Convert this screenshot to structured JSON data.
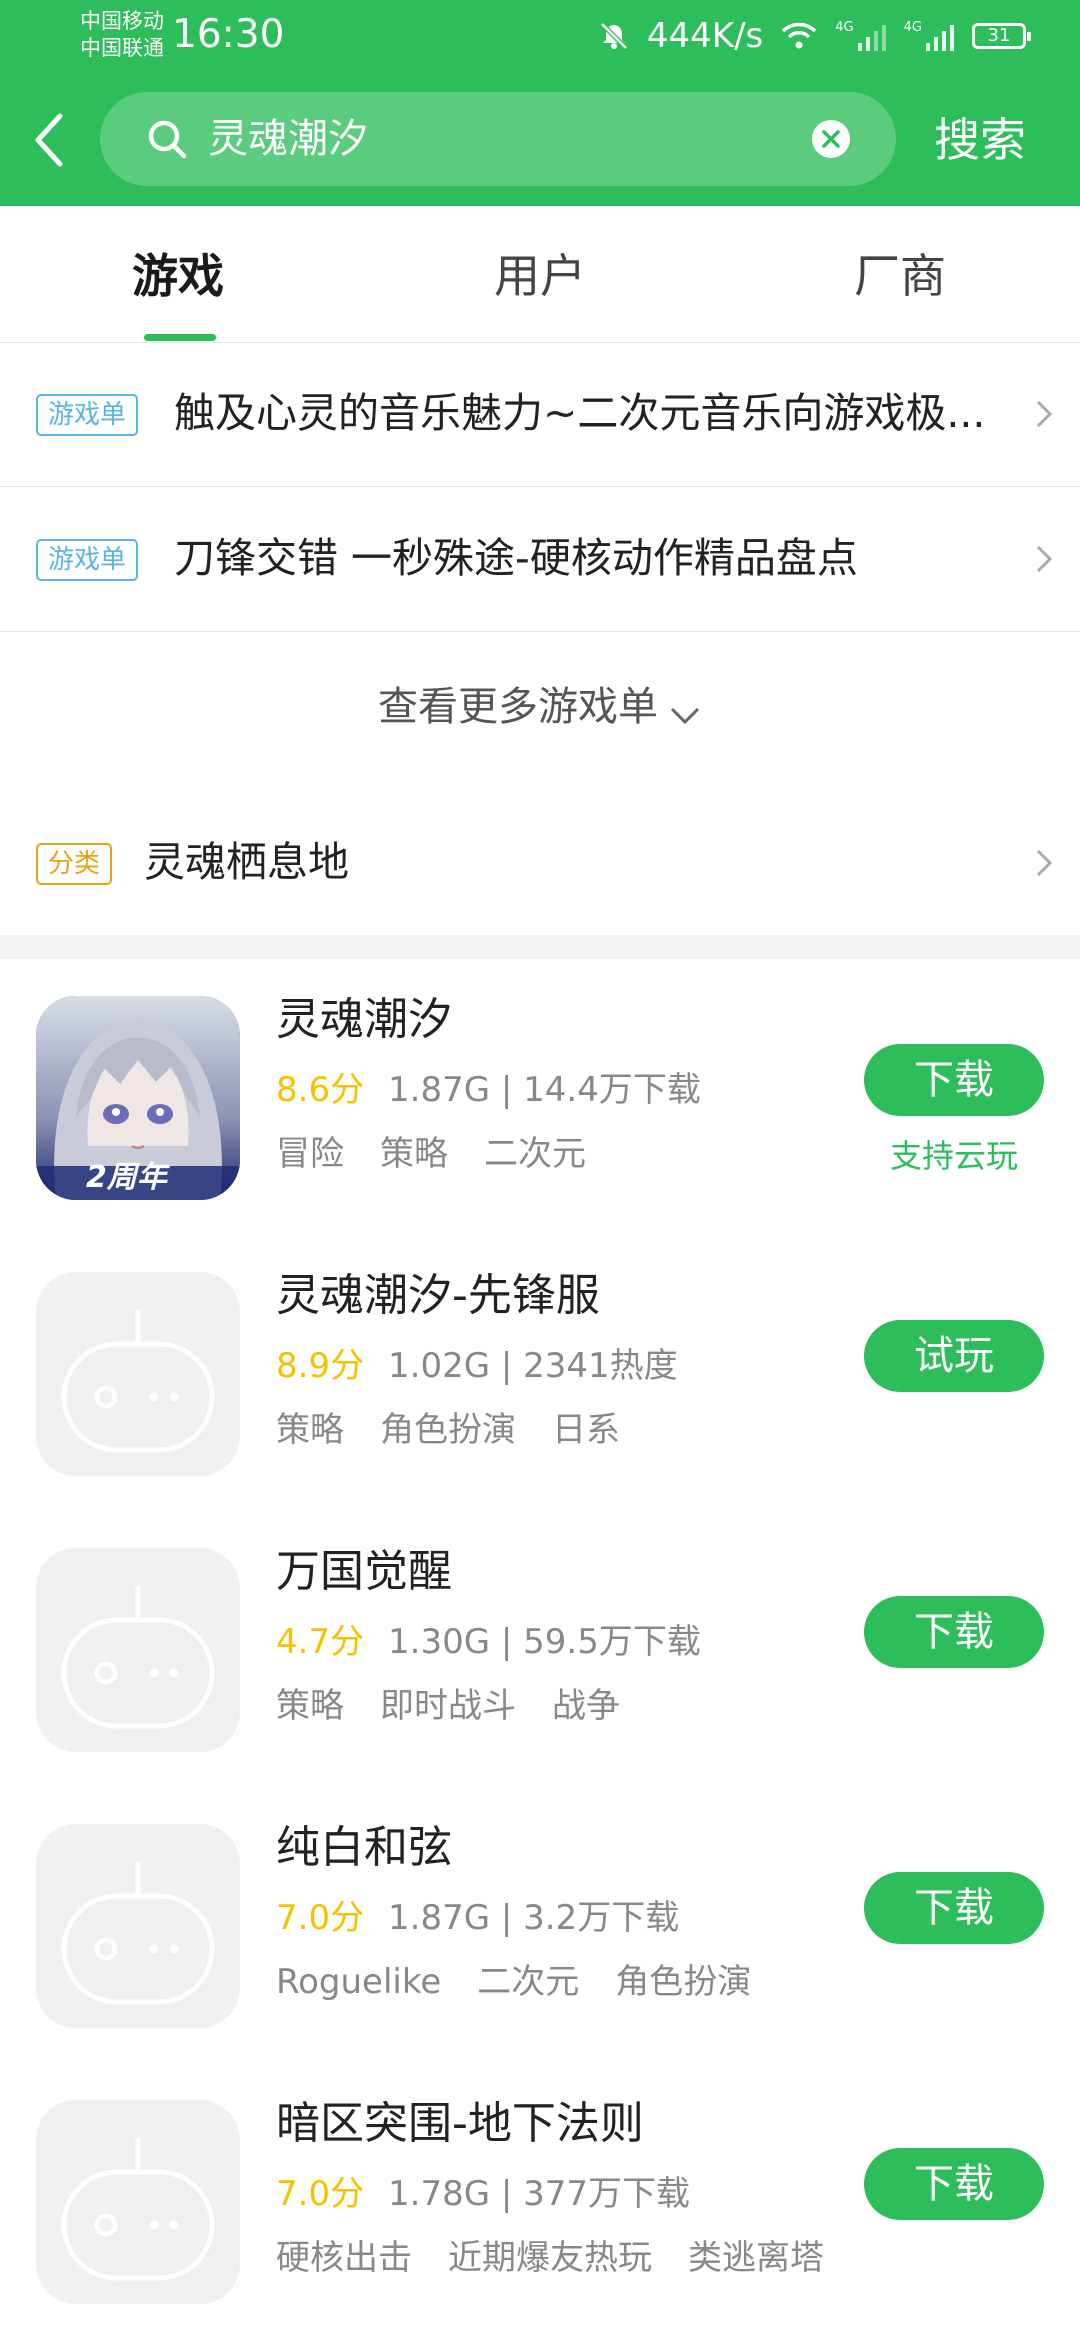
{
  "status": {
    "carrier1": "中国移动",
    "carrier2": "中国联通",
    "time": "16:30",
    "speed": "444K/s",
    "net1": "4G",
    "net2": "4G",
    "battery": "31"
  },
  "search": {
    "query": "灵魂潮汐",
    "button": "搜索"
  },
  "tabs": [
    "游戏",
    "用户",
    "厂商"
  ],
  "lists": [
    {
      "tag": "游戏单",
      "text": "触及心灵的音乐魅力~二次元音乐向游戏极..."
    },
    {
      "tag": "游戏单",
      "text": "刀锋交错 一秒殊途-硬核动作精品盘点"
    }
  ],
  "more_label": "查看更多游戏单",
  "category": {
    "tag": "分类",
    "text": "灵魂栖息地"
  },
  "games": [
    {
      "name": "灵魂潮汐",
      "score": "8.6分",
      "meta": "1.87G | 14.4万下载",
      "tags": [
        "冒险",
        "策略",
        "二次元"
      ],
      "button": "下载",
      "cloud": "支持云玩",
      "badge": "2周年"
    },
    {
      "name": "灵魂潮汐-先锋服",
      "score": "8.9分",
      "meta": "1.02G | 2341热度",
      "tags": [
        "策略",
        "角色扮演",
        "日系"
      ],
      "button": "试玩"
    },
    {
      "name": "万国觉醒",
      "score": "4.7分",
      "meta": "1.30G | 59.5万下载",
      "tags": [
        "策略",
        "即时战斗",
        "战争"
      ],
      "button": "下载"
    },
    {
      "name": "纯白和弦",
      "score": "7.0分",
      "meta": "1.87G | 3.2万下载",
      "tags": [
        "Roguelike",
        "二次元",
        "角色扮演"
      ],
      "button": "下载"
    },
    {
      "name": "暗区突围-地下法则",
      "score": "7.0分",
      "meta": "1.78G | 377万下载",
      "tags": [
        "硬核出击",
        "近期爆友热玩",
        "类逃离塔"
      ],
      "button": "下载"
    }
  ],
  "colors": {
    "primary": "#2dbd5a",
    "score": "#f5c200",
    "tag_blue": "#5ab4e6",
    "tag_orange": "#e8a21a"
  }
}
